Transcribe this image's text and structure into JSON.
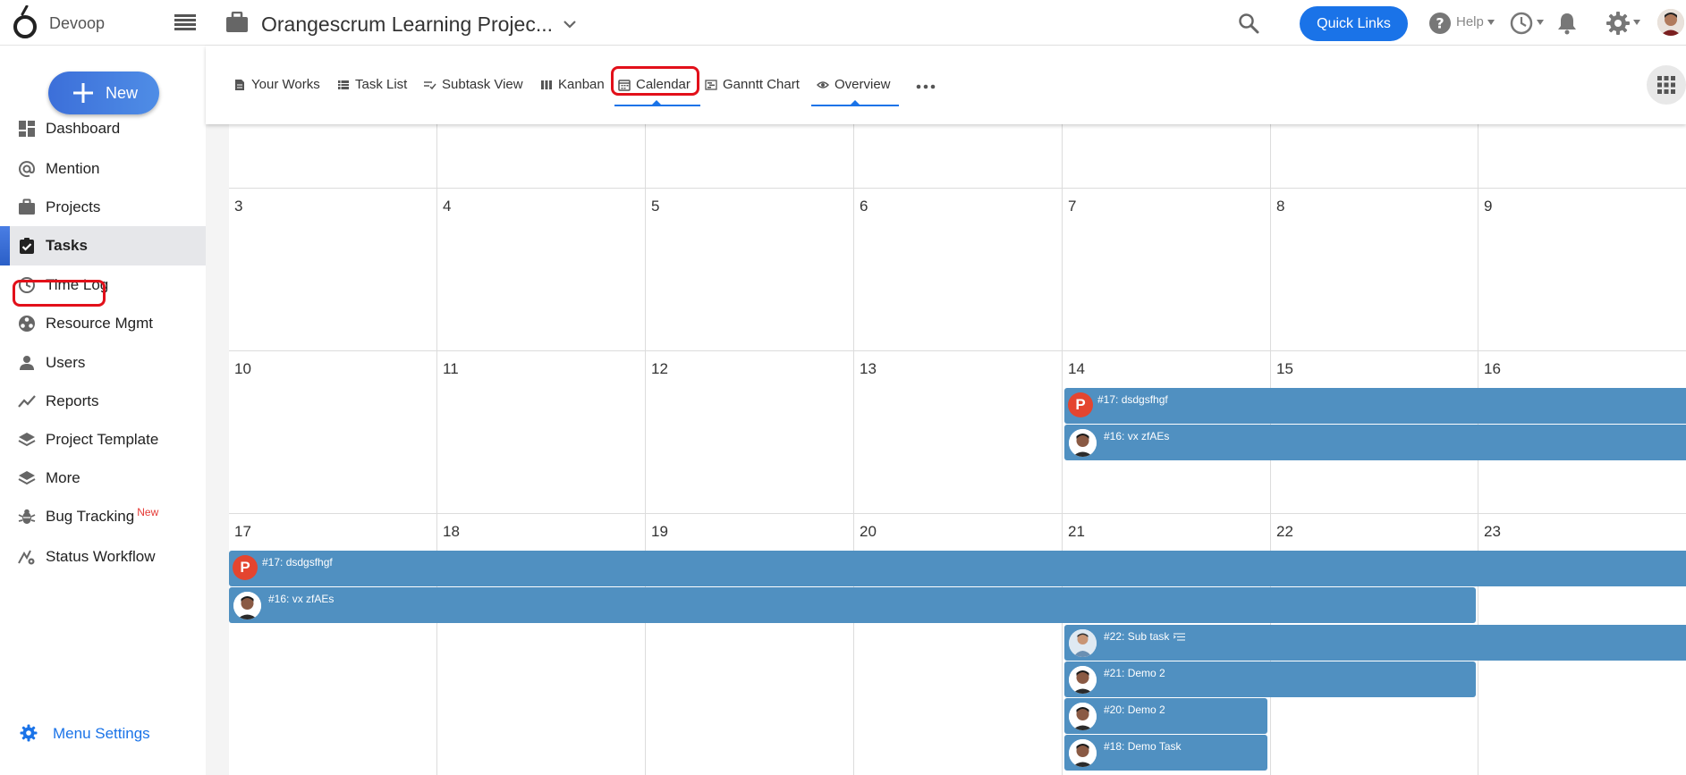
{
  "header": {
    "brand": "Devoop",
    "project_title": "Orangescrum Learning Projec...",
    "quick_links": "Quick Links",
    "help": "Help"
  },
  "sidebar": {
    "new_label": "New",
    "items": [
      {
        "label": "Dashboard",
        "icon": "dashboard-icon"
      },
      {
        "label": "Mention",
        "icon": "at-icon"
      },
      {
        "label": "Projects",
        "icon": "briefcase-icon"
      },
      {
        "label": "Tasks",
        "icon": "clipboard-check-icon",
        "active": true
      },
      {
        "label": "Time Log",
        "icon": "clock-icon"
      },
      {
        "label": "Resource Mgmt",
        "icon": "resource-icon"
      },
      {
        "label": "Users",
        "icon": "user-icon"
      },
      {
        "label": "Reports",
        "icon": "trend-icon"
      },
      {
        "label": "Project Template",
        "icon": "layers-icon"
      },
      {
        "label": "More",
        "icon": "layers-icon"
      },
      {
        "label": "Bug Tracking",
        "icon": "bug-icon",
        "badge": "New"
      },
      {
        "label": "Status Workflow",
        "icon": "workflow-icon"
      }
    ],
    "menu_settings": "Menu Settings"
  },
  "views": {
    "tabs": [
      {
        "label": "Your Works",
        "icon": "document-icon"
      },
      {
        "label": "Task List",
        "icon": "list-icon"
      },
      {
        "label": "Subtask View",
        "icon": "subtask-icon"
      },
      {
        "label": "Kanban",
        "icon": "kanban-icon"
      },
      {
        "label": "Calendar",
        "icon": "calendar-icon",
        "active": true
      },
      {
        "label": "Ganntt Chart",
        "icon": "gantt-icon"
      },
      {
        "label": "Overview",
        "icon": "eye-icon"
      }
    ]
  },
  "calendar": {
    "weeks": [
      [
        "",
        "",
        "",
        "",
        "",
        "",
        ""
      ],
      [
        "3",
        "4",
        "5",
        "6",
        "7",
        "8",
        "9"
      ],
      [
        "10",
        "11",
        "12",
        "13",
        "14",
        "15",
        "16"
      ],
      [
        "17",
        "18",
        "19",
        "20",
        "21",
        "22",
        "23"
      ]
    ],
    "events": [
      {
        "id": "e1",
        "label": "#17: dsdgsfhgf",
        "badge": "P"
      },
      {
        "id": "e2",
        "label": "#16: vx zfAEs"
      },
      {
        "id": "e3",
        "label": "#17: dsdgsfhgf",
        "badge": "P"
      },
      {
        "id": "e4",
        "label": "#16: vx zfAEs"
      },
      {
        "id": "e5",
        "label": "#22: Sub task",
        "subtask": true
      },
      {
        "id": "e6",
        "label": "#21: Demo 2"
      },
      {
        "id": "e7",
        "label": "#20: Demo 2"
      },
      {
        "id": "e8",
        "label": "#18: Demo Task"
      }
    ]
  },
  "colors": {
    "accent": "#1a73e8",
    "event": "#5090c1",
    "badge_p": "#e4452f",
    "highlight": "#e2101a"
  }
}
